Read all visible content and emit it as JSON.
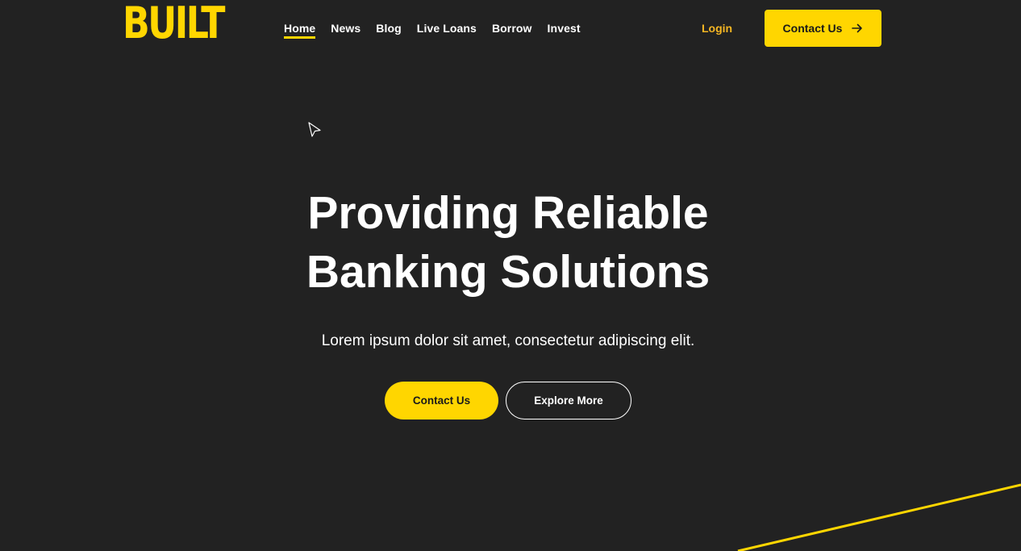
{
  "brand": {
    "logo_text": "BUILT",
    "accent_color": "#FFD600",
    "login_color": "#F5B623",
    "background_color": "#222222"
  },
  "nav": {
    "items": [
      {
        "label": "Home",
        "active": true
      },
      {
        "label": "News"
      },
      {
        "label": "Blog"
      },
      {
        "label": "Live Loans"
      },
      {
        "label": "Borrow"
      },
      {
        "label": "Invest"
      }
    ],
    "login_label": "Login",
    "contact_label": "Contact Us",
    "contact_icon": "arrow-right-icon"
  },
  "hero": {
    "title_line1": "Providing Reliable",
    "title_line2": "Banking Solutions",
    "subtitle": "Lorem ipsum dolor sit amet, consectetur adipiscing elit.",
    "primary_button": "Contact Us",
    "secondary_button": "Explore More"
  },
  "decor": {
    "cursor_icon": "mouse-pointer-icon",
    "diagonal_line_color": "#FFD600"
  }
}
